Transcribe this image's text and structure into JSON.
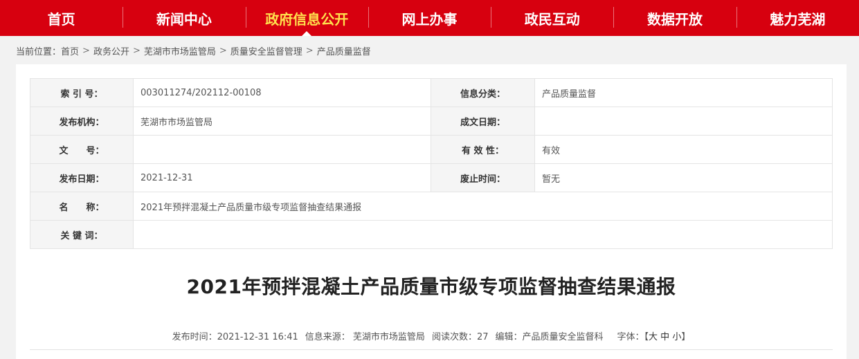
{
  "nav": {
    "items": [
      {
        "label": "首页"
      },
      {
        "label": "新闻中心"
      },
      {
        "label": "政府信息公开"
      },
      {
        "label": "网上办事"
      },
      {
        "label": "政民互动"
      },
      {
        "label": "数据开放"
      },
      {
        "label": "魅力芜湖"
      }
    ],
    "active_index": 2,
    "bg_color": "#d7000f",
    "active_color": "#ffe14d"
  },
  "breadcrumb": {
    "prefix": "当前位置：",
    "items": [
      "首页",
      "政务公开",
      "芜湖市市场监管局",
      "质量安全监督管理",
      "产品质量监督"
    ],
    "separator": ">"
  },
  "info": {
    "index_no_label": "索 引 号：",
    "index_no": "003011274/202112-00108",
    "category_label": "信息分类：",
    "category": "产品质量监督",
    "publisher_label": "发布机构：",
    "publisher": "芜湖市市场监管局",
    "created_label": "成文日期：",
    "created": "",
    "doc_no_label": "文　　号：",
    "doc_no": "",
    "validity_label": "有 效 性：",
    "validity": "有效",
    "pub_date_label": "发布日期：",
    "pub_date": "2021-12-31",
    "abolish_label": "废止时间：",
    "abolish": "暂无",
    "name_label": "名　　称：",
    "name": "2021年预拌混凝土产品质量市级专项监督抽查结果通报",
    "keywords_label": "关 键 词：",
    "keywords": ""
  },
  "article": {
    "title": "2021年预拌混凝土产品质量市级专项监督抽查结果通报",
    "publish_time": "发布时间：2021-12-31 16:41",
    "source": "信息来源： 芜湖市市场监管局",
    "views": "阅读次数：27",
    "editor": "编辑：产品质量安全监督科",
    "font_size_prefix": "字体：【",
    "font_large": "大",
    "font_medium": "中",
    "font_small": "小",
    "font_size_suffix": "】"
  }
}
